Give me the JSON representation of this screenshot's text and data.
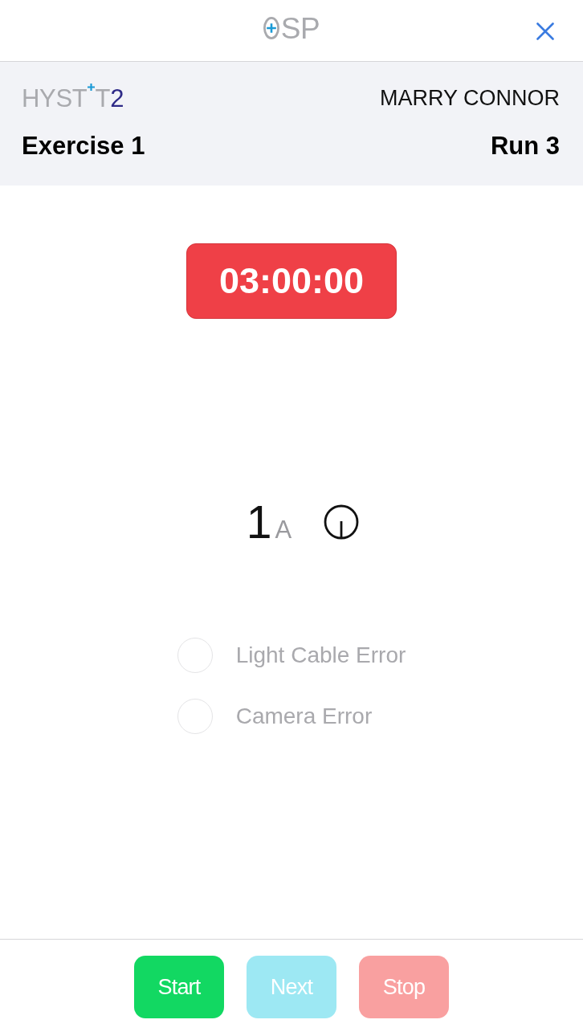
{
  "top_bar": {
    "logo": "SP"
  },
  "header": {
    "brand": {
      "prefix": "HYST",
      "suffix": "T",
      "version": "2"
    },
    "user": "MARRY CONNOR",
    "exercise": "Exercise 1",
    "run": "Run 3"
  },
  "timer": {
    "value": "03:00:00"
  },
  "position": {
    "number": "1",
    "letter": "A"
  },
  "errors": [
    {
      "label": "Light Cable Error",
      "checked": false
    },
    {
      "label": "Camera Error",
      "checked": false
    }
  ],
  "buttons": [
    {
      "kind": "start",
      "label": "Start",
      "disabled": false
    },
    {
      "kind": "next",
      "label": "Next",
      "disabled": true
    },
    {
      "kind": "stop",
      "label": "Stop",
      "disabled": true
    }
  ]
}
